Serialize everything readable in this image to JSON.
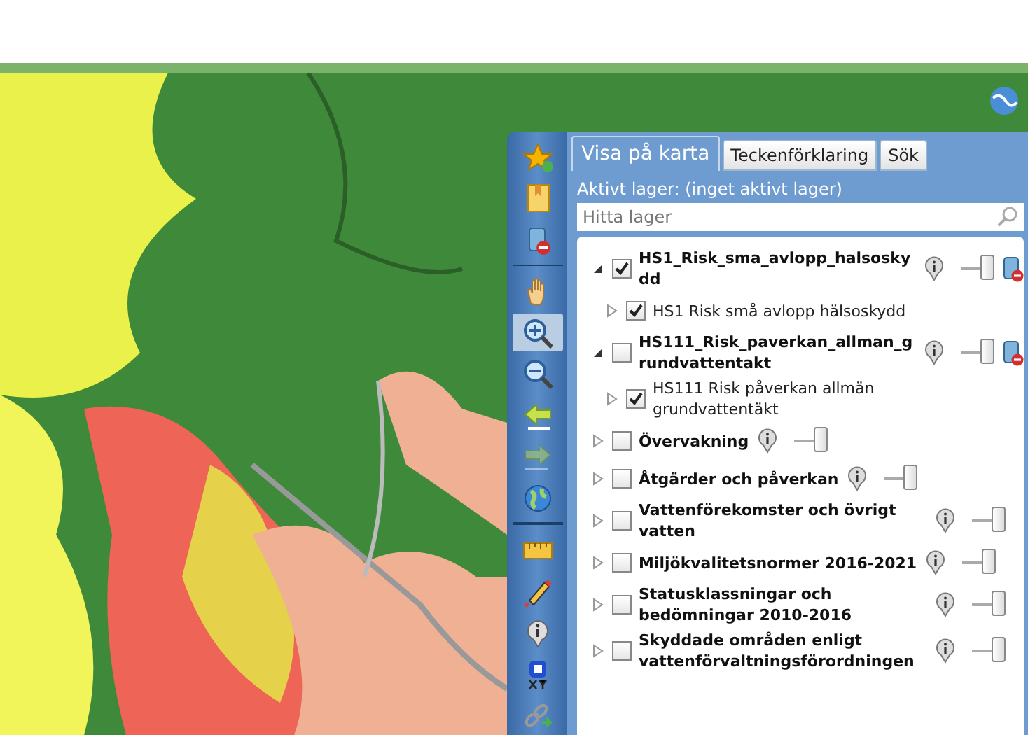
{
  "toolbar": [
    {
      "kind": "add-favorite",
      "selected": false,
      "disabled": false
    },
    {
      "kind": "bookmark",
      "selected": false,
      "disabled": false
    },
    {
      "kind": "remove-layers",
      "selected": false,
      "disabled": false
    },
    {
      "kind": "divider"
    },
    {
      "kind": "pan",
      "selected": false,
      "disabled": false
    },
    {
      "kind": "zoom-in",
      "selected": true,
      "disabled": false
    },
    {
      "kind": "zoom-out",
      "selected": false,
      "disabled": false
    },
    {
      "kind": "back",
      "selected": false,
      "disabled": false
    },
    {
      "kind": "forward",
      "selected": false,
      "disabled": true
    },
    {
      "kind": "globe",
      "selected": false,
      "disabled": false
    },
    {
      "kind": "divider"
    },
    {
      "kind": "measure",
      "selected": false,
      "disabled": false
    },
    {
      "kind": "draw",
      "selected": false,
      "disabled": false
    },
    {
      "kind": "info",
      "selected": false,
      "disabled": false
    },
    {
      "kind": "coordinates",
      "selected": false,
      "disabled": false
    },
    {
      "kind": "link",
      "selected": false,
      "disabled": false
    }
  ],
  "panel": {
    "tabs": [
      {
        "label": "Visa på karta",
        "selected": true
      },
      {
        "label": "Teckenförklaring",
        "selected": false
      },
      {
        "label": "Sök",
        "selected": false
      }
    ],
    "active_layer": "Aktivt lager:  (inget aktivt lager)",
    "search": {
      "placeholder": "Hitta lager"
    },
    "layers": [
      {
        "name": "HS1_Risk_sma_avlopp_halsoskydd",
        "expanded": true,
        "checked": true,
        "level": 1,
        "removable": true,
        "children": [
          {
            "name": "HS1 Risk små avlopp hälsoskydd",
            "checked": true
          }
        ]
      },
      {
        "name": "HS111_Risk_paverkan_allman_grundvattentakt",
        "expanded": true,
        "checked": false,
        "level": 1,
        "removable": true,
        "children": [
          {
            "name": "HS111 Risk påverkan allmän grundvattentäkt",
            "checked": true
          }
        ]
      },
      {
        "name": "Övervakning",
        "expanded": false,
        "checked": false,
        "level": 1,
        "removable": false
      },
      {
        "name": "Åtgärder och påverkan",
        "expanded": false,
        "checked": false,
        "level": 1,
        "removable": false
      },
      {
        "name": "Vattenförekomster och övrigt vatten",
        "expanded": false,
        "checked": false,
        "level": 1,
        "removable": false
      },
      {
        "name": "Miljökvalitetsnormer 2016-2021",
        "expanded": false,
        "checked": false,
        "level": 1,
        "removable": false
      },
      {
        "name": "Statusklassningar och bedömningar 2010-2016",
        "expanded": false,
        "checked": false,
        "level": 1,
        "removable": false
      },
      {
        "name": "Skyddade områden enligt vattenförvaltningsförordningen",
        "expanded": false,
        "checked": false,
        "level": 1,
        "removable": false
      }
    ]
  }
}
